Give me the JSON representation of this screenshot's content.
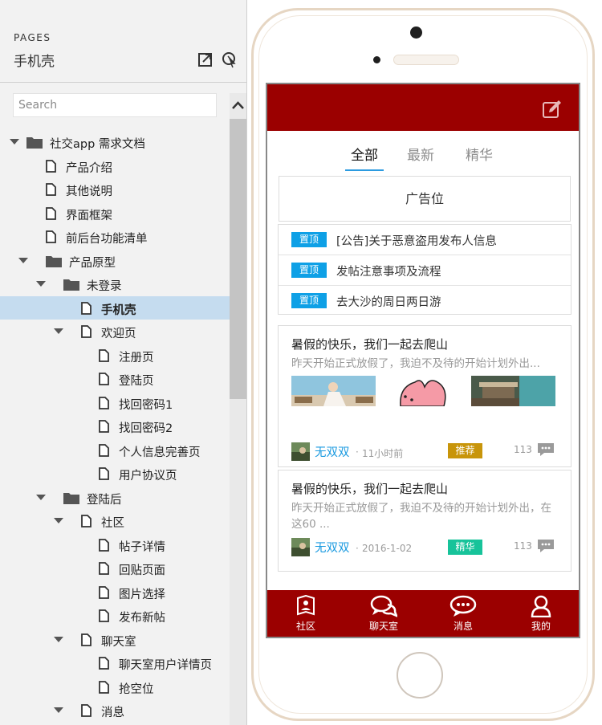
{
  "sidebar": {
    "heading": "PAGES",
    "project_title": "手机壳",
    "search_placeholder": "Search",
    "tree": [
      {
        "label": "社交app 需求文档",
        "level": 0,
        "type": "folder",
        "expanded": true
      },
      {
        "label": "产品介绍",
        "level": 1,
        "type": "page"
      },
      {
        "label": "其他说明",
        "level": 1,
        "type": "page"
      },
      {
        "label": "界面框架",
        "level": 1,
        "type": "page"
      },
      {
        "label": "前后台功能清单",
        "level": 1,
        "type": "page"
      },
      {
        "label": "产品原型",
        "level": 1,
        "type": "folder",
        "expanded": true
      },
      {
        "label": "未登录",
        "level": 2,
        "type": "folder",
        "expanded": true
      },
      {
        "label": "手机壳",
        "level": 3,
        "type": "page",
        "selected": true
      },
      {
        "label": "欢迎页",
        "level": 3,
        "type": "page",
        "expanded": true
      },
      {
        "label": "注册页",
        "level": 4,
        "type": "page"
      },
      {
        "label": "登陆页",
        "level": 4,
        "type": "page"
      },
      {
        "label": "找回密码1",
        "level": 4,
        "type": "page"
      },
      {
        "label": "找回密码2",
        "level": 4,
        "type": "page"
      },
      {
        "label": "个人信息完善页",
        "level": 4,
        "type": "page"
      },
      {
        "label": "用户协议页",
        "level": 4,
        "type": "page"
      },
      {
        "label": "登陆后",
        "level": 2,
        "type": "folder",
        "expanded": true
      },
      {
        "label": "社区",
        "level": 3,
        "type": "page",
        "expanded": true
      },
      {
        "label": "帖子详情",
        "level": 4,
        "type": "page"
      },
      {
        "label": "回贴页面",
        "level": 4,
        "type": "page"
      },
      {
        "label": "图片选择",
        "level": 4,
        "type": "page"
      },
      {
        "label": "发布新帖",
        "level": 4,
        "type": "page"
      },
      {
        "label": "聊天室",
        "level": 3,
        "type": "page",
        "expanded": true
      },
      {
        "label": "聊天室用户详情页",
        "level": 4,
        "type": "page"
      },
      {
        "label": "抢空位",
        "level": 4,
        "type": "page"
      },
      {
        "label": "消息",
        "level": 3,
        "type": "page",
        "expanded": true
      }
    ]
  },
  "app": {
    "tabs": [
      "全部",
      "最新",
      "精华"
    ],
    "active_tab": 0,
    "ad_label": "广告位",
    "pinned": [
      {
        "tag": "置顶",
        "text": "[公告]关于恶意盗用发布人信息"
      },
      {
        "tag": "置顶",
        "text": "发帖注意事项及流程"
      },
      {
        "tag": "置顶",
        "text": "去大沙的周日两日游"
      }
    ],
    "posts": [
      {
        "title": "暑假的快乐，我们一起去爬山",
        "desc": "昨天开始正式放假了，我迫不及待的开始计划外出...",
        "author": "无双双",
        "time": "11小时前",
        "badge": "推荐",
        "badge_color": "#c8950a",
        "count": "113"
      },
      {
        "title": "暑假的快乐，我们一起去爬山",
        "desc": "昨天开始正式放假了，我迫不及待的开始计划外出，在这60 ...",
        "author": "无双双",
        "time": "2016-1-02",
        "badge": "精华",
        "badge_color": "#17c39a",
        "count": "113"
      }
    ],
    "nav": [
      "社区",
      "聊天室",
      "消息",
      "我的"
    ],
    "colors": {
      "brand": "#9b0000",
      "accent": "#0ea0e6",
      "tab_underline": "#2c9be0"
    }
  }
}
